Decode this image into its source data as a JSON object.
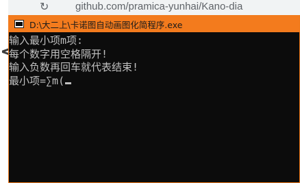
{
  "background": {
    "url_fragment": "github.com/pramica-yunhai/Kano-dia",
    "left_glyph": "<"
  },
  "window": {
    "title": "D:\\大二上\\卡诺图自动画图化简程序.exe",
    "accent_color": "#f37b1d"
  },
  "console": {
    "lines": [
      "输入最小项m项:",
      "每个数字用空格隔开!",
      "输入负数再回车就代表结束!",
      "最小项=∑m("
    ],
    "text_color": "#c0c0c0",
    "background_color": "#0c0c0c"
  }
}
